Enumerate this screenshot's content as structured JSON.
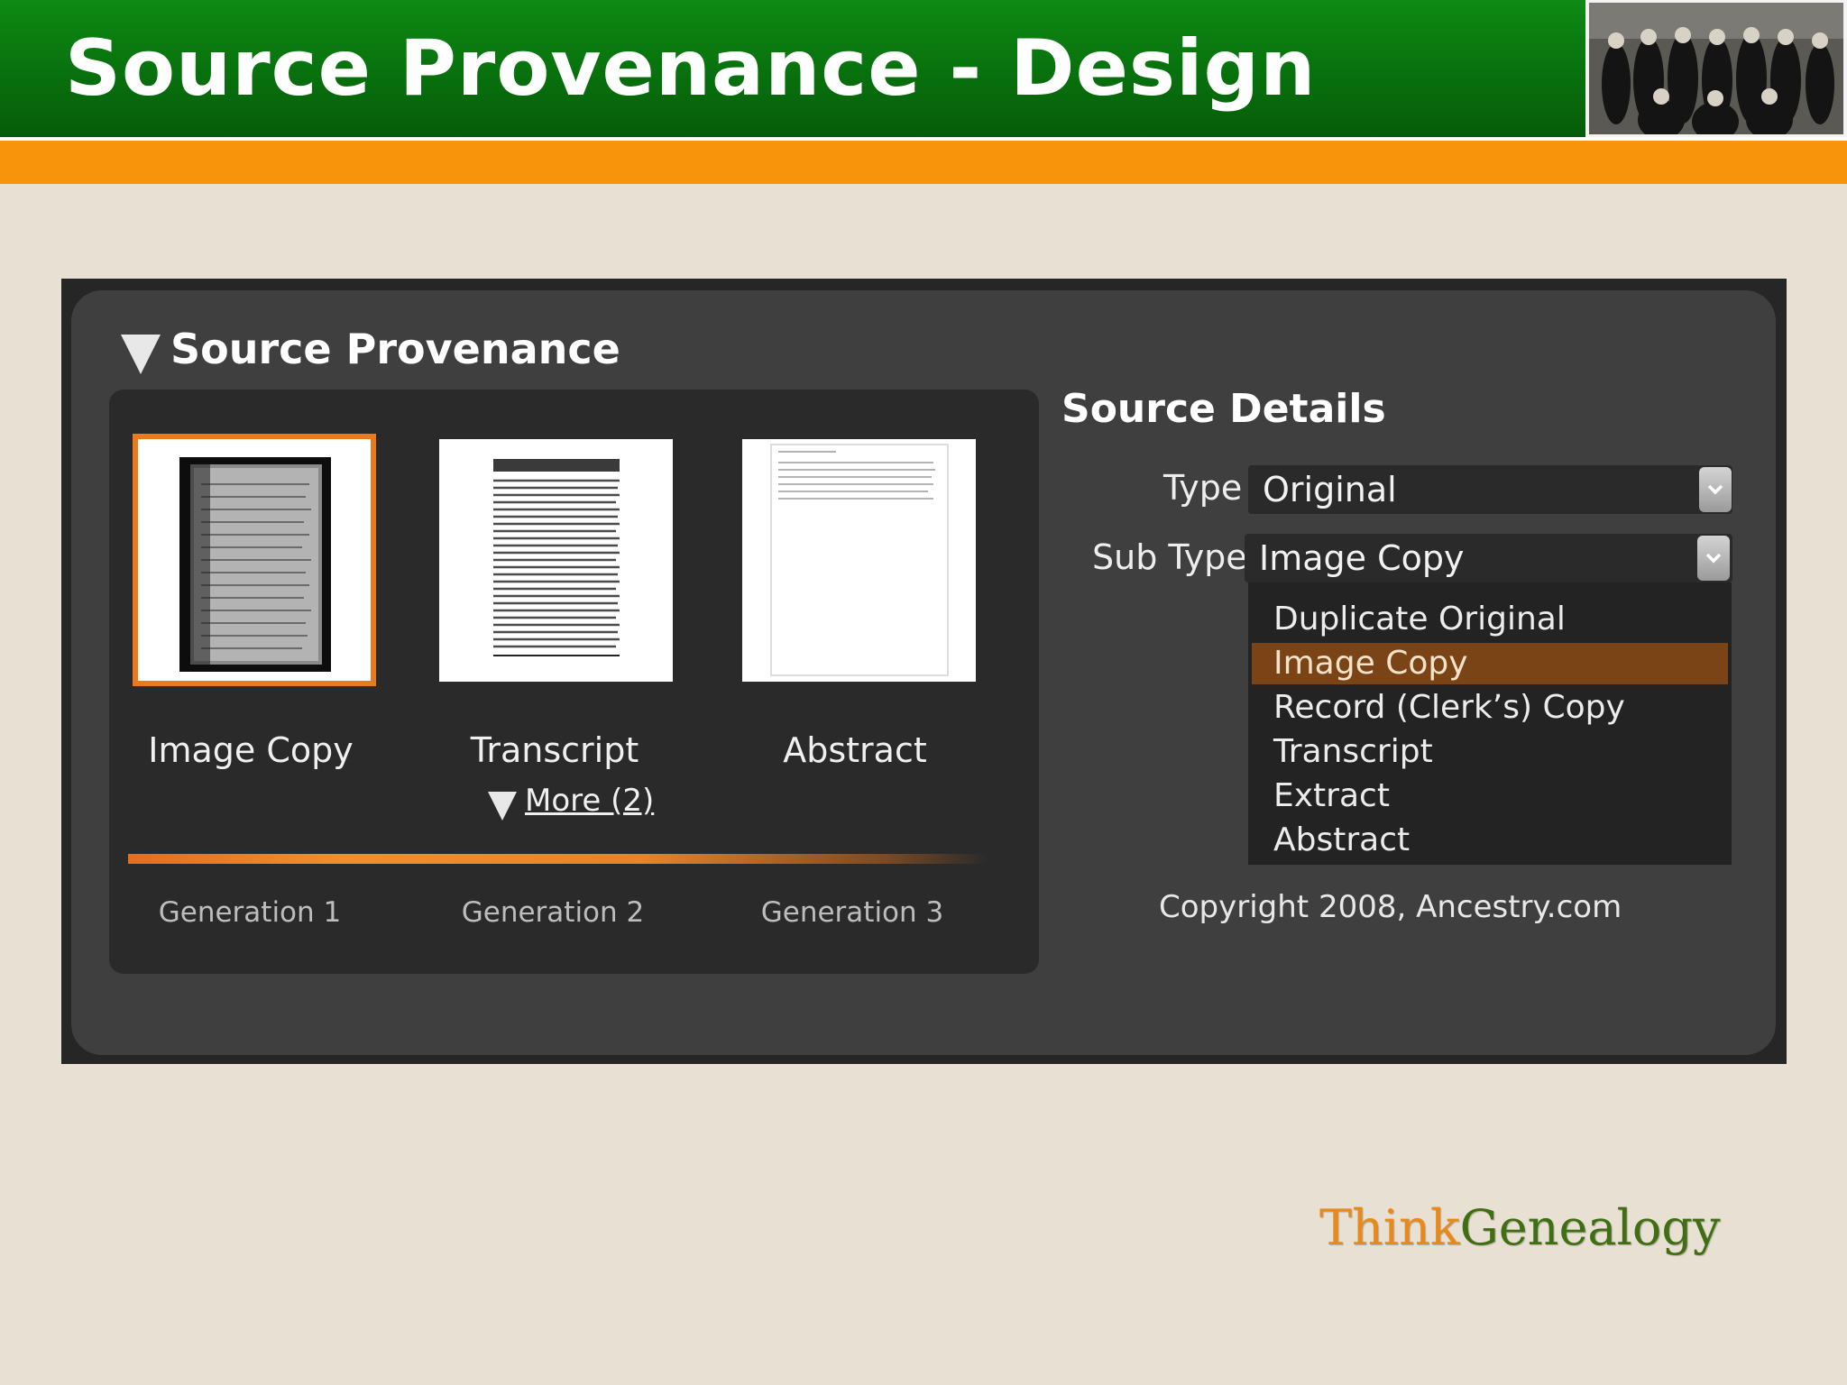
{
  "slide": {
    "title": "Source Provenance - Design"
  },
  "panel": {
    "section_title": "Source Provenance",
    "cards": [
      {
        "label": "Image Copy",
        "selected": true
      },
      {
        "label": "Transcript",
        "selected": false
      },
      {
        "label": "Abstract",
        "selected": false
      }
    ],
    "more_link": "More (2)",
    "generations": [
      "Generation 1",
      "Generation 2",
      "Generation 3"
    ]
  },
  "details": {
    "title": "Source Details",
    "type_label": "Type",
    "type_value": "Original",
    "subtype_label": "Sub Type",
    "subtype_value": "Image Copy",
    "options": [
      "Duplicate Original",
      "Image Copy",
      "Record (Clerk’s) Copy",
      "Transcript",
      "Extract",
      "Abstract"
    ],
    "highlighted_option": "Image Copy",
    "copyright": "Copyright 2008, Ancestry.com"
  },
  "brand": {
    "think": "Think",
    "genealogy": "Genealogy"
  },
  "colors": {
    "header_green": "#08700d",
    "accent_orange": "#f7940b",
    "selection_orange": "#ea7a1b",
    "highlight_brown": "#7a4416",
    "brand_think": "#e8891a",
    "brand_genealogy": "#3f6f12"
  },
  "icons": {
    "collapse": "triangle-down-icon",
    "dropdown": "chevron-down-icon"
  }
}
